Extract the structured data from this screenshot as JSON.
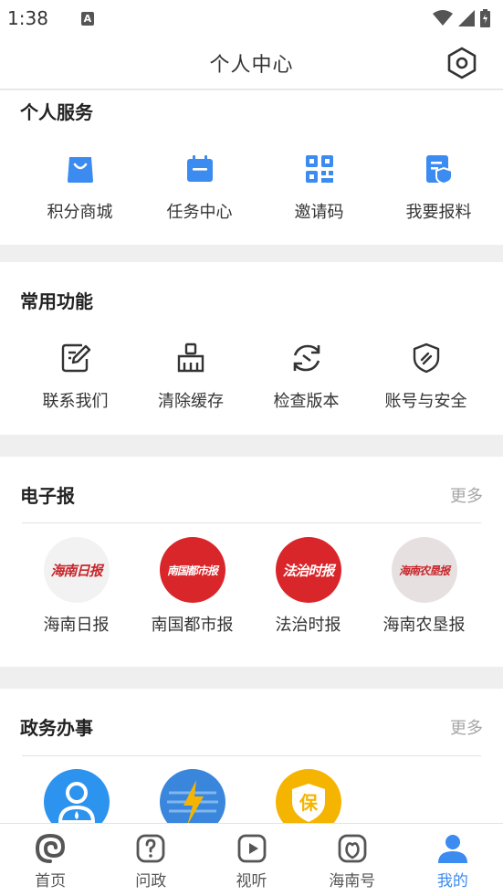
{
  "status": {
    "time": "1:38",
    "notif_glyph": "A"
  },
  "header": {
    "title": "个人中心",
    "settings_icon": "settings-hexagon-icon"
  },
  "personal_services": {
    "title": "个人服务",
    "items": [
      {
        "label": "积分商城",
        "icon": "shopping-bag-icon"
      },
      {
        "label": "任务中心",
        "icon": "calendar-icon"
      },
      {
        "label": "邀请码",
        "icon": "qr-code-icon"
      },
      {
        "label": "我要报料",
        "icon": "report-shield-icon"
      }
    ]
  },
  "common_functions": {
    "title": "常用功能",
    "items": [
      {
        "label": "联系我们",
        "icon": "edit-note-icon"
      },
      {
        "label": "清除缓存",
        "icon": "broom-icon"
      },
      {
        "label": "检查版本",
        "icon": "refresh-icon"
      },
      {
        "label": "账号与安全",
        "icon": "security-shield-icon"
      }
    ]
  },
  "epaper": {
    "title": "电子报",
    "more": "更多",
    "items": [
      {
        "label": "海南日报",
        "logo": "海南日报"
      },
      {
        "label": "南国都市报",
        "logo": "南国都市报"
      },
      {
        "label": "法治时报",
        "logo": "法治时报"
      },
      {
        "label": "海南农垦报",
        "logo": "海南农垦报"
      }
    ]
  },
  "government": {
    "title": "政务办事",
    "more": "更多",
    "items": [
      {
        "icon": "person-service-icon"
      },
      {
        "icon": "lightning-globe-icon"
      },
      {
        "icon": "insurance-badge-icon",
        "glyph": "保"
      }
    ]
  },
  "tabbar": {
    "tabs": [
      {
        "label": "首页",
        "icon": "home-swirl-icon",
        "active": false
      },
      {
        "label": "问政",
        "icon": "question-bubble-icon",
        "active": false
      },
      {
        "label": "视听",
        "icon": "play-icon",
        "active": false
      },
      {
        "label": "海南号",
        "icon": "hainan-account-icon",
        "active": false
      },
      {
        "label": "我的",
        "icon": "user-icon",
        "active": true
      }
    ]
  },
  "colors": {
    "accent": "#3b8bf0",
    "red_paper": "#d9262a",
    "gold": "#f5b400"
  }
}
